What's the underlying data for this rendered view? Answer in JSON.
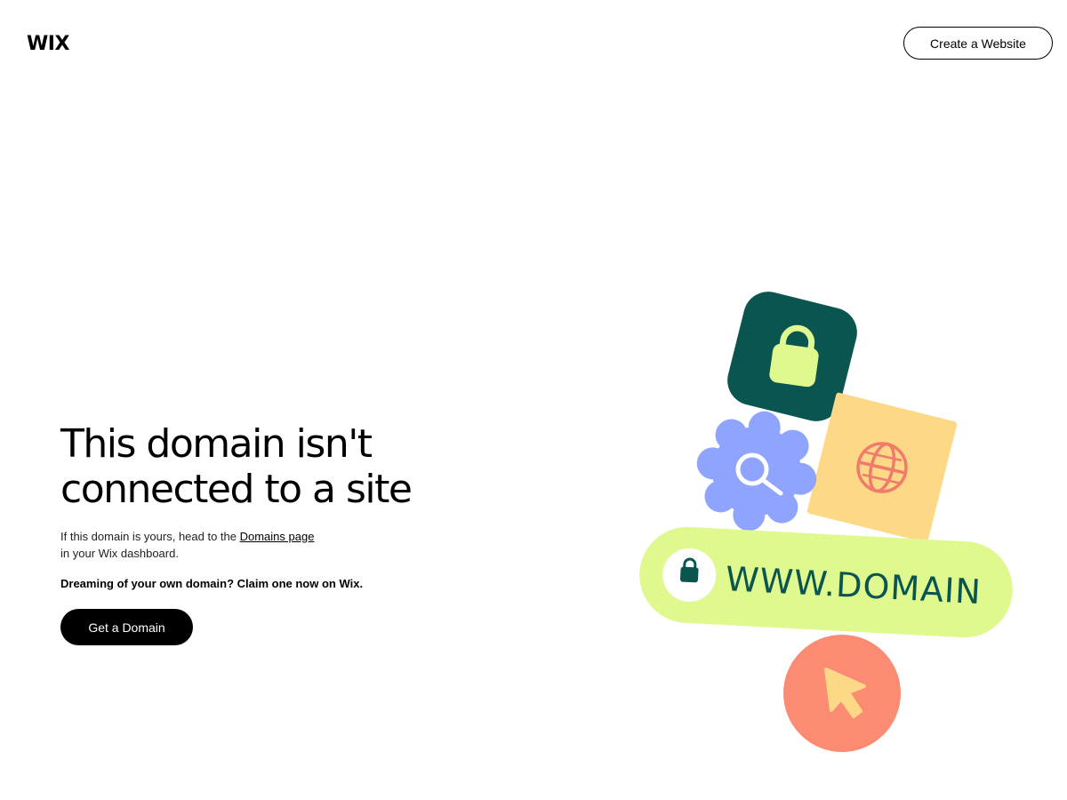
{
  "header": {
    "logo_text": "WIX",
    "create_button_label": "Create a Website"
  },
  "main": {
    "headline_line1": "This domain isn't",
    "headline_line2": "connected to a site",
    "description_prefix": "If this domain is yours, head to the ",
    "description_link": "Domains page",
    "description_suffix": "in your Wix dashboard.",
    "promo_text": "Dreaming of your own domain? Claim one now on Wix.",
    "cta_label": "Get a Domain"
  },
  "illustration": {
    "url_text": "WWW.DOMAIN",
    "icons": [
      "lock-icon",
      "search-icon",
      "globe-icon",
      "padlock-icon",
      "cursor-icon"
    ],
    "colors": {
      "dark_green": "#0A5550",
      "lime": "#E0F98F",
      "lavender": "#8FA4FF",
      "yellow": "#FDD987",
      "coral": "#FB8B72",
      "coral_line": "#F27A6B",
      "cursor_yellow": "#FDD987"
    }
  }
}
